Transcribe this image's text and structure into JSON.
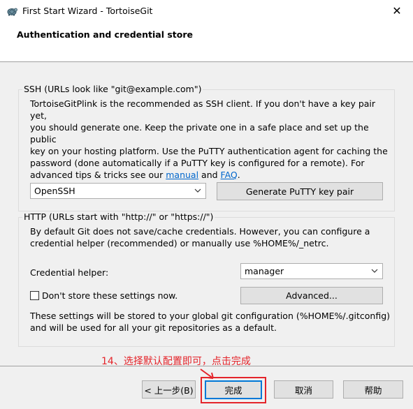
{
  "window": {
    "title": "First Start Wizard - TortoiseGit",
    "close_label": "✕"
  },
  "header": {
    "title": "Authentication and credential store"
  },
  "ssh": {
    "legend": "SSH (URLs look like \"git@example.com\")",
    "desc_line1": "TortoiseGitPlink is the recommended as SSH client. If you don't have a key pair yet,",
    "desc_line2": "you should generate one. Keep the private one in a safe place and set up the public",
    "desc_line3": "key on your hosting platform. Use the PuTTY authentication agent for caching the",
    "desc_line4": "password (done automatically if a PuTTY key is configured for a remote). For",
    "desc_line5_prefix": "advanced tips & tricks see our ",
    "manual_link": "manual",
    "and_text": " and ",
    "faq_link": "FAQ",
    "period": ".",
    "client_selected": "OpenSSH",
    "generate_button": "Generate PuTTY  key pair"
  },
  "http": {
    "legend": "HTTP (URLs start with \"http://\" or \"https://\")",
    "desc_line1": "By default Git does not save/cache credentials. However, you can configure a",
    "desc_line2": "credential helper (recommended) or manually use %HOME%/_netrc.",
    "credential_helper_label": "Credential helper:",
    "credential_helper_selected": "manager",
    "dont_store_label": "Don't store these settings now.",
    "dont_store_checked": false,
    "advanced_button": "Advanced...",
    "note_line1": "These settings will be stored to your global git configuration (%HOME%/.gitconfig)",
    "note_line2": "and will be used for all your git repositories as a default."
  },
  "annotation": {
    "text": "14、选择默认配置即可，点击完成",
    "color": "#e4242a"
  },
  "footer": {
    "back_button": "< 上一步(B)",
    "finish_button": "完成",
    "cancel_button": "取消",
    "help_button": "帮助"
  },
  "icons": {
    "app": "tortoise-icon",
    "close": "close-icon",
    "dropdown": "chevron-down-icon"
  }
}
